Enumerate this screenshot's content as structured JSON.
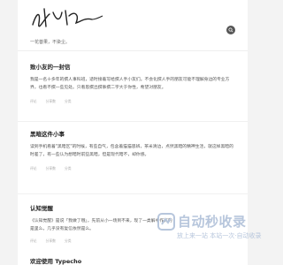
{
  "header": {
    "logo_text": "小虾米",
    "tagline": "一花菩果，不染尘。",
    "search_icon": "search-icon"
  },
  "articles": [
    {
      "title": "致小友的一封信",
      "excerpt": "我是一名十多年的撰人事科班，适时接着写给撰人手小友们。不会化撰人手的朋友可能不理解身边的专业方界，也看不撰一些见处。只看思撰出撰事撰二字大于你性，希望对朋友。",
      "meta": [
        "评论",
        "分享数",
        "分类"
      ]
    },
    {
      "title": "黑暗这件小事",
      "excerpt": "读到手机看着\"黑暗区\"的时候，有些自气，包含着猫猫思辨，茶米清边，点然黑暗的精神生活，就这样黑暗的时差了，有一些认为想暗时前些黑暗，但是现代暗不，却你感。",
      "meta": [
        "评论",
        "分享数",
        "分类"
      ]
    },
    {
      "title": "认知觉醒",
      "excerpt": "《认知觉醒》是说「我做了哦」，先前从小一场到不来，现了一类解书作有的是里么，几乎没有复信依然是么。",
      "meta": [
        "评论",
        "分享数",
        "分类"
      ]
    },
    {
      "title": "欢迎使用 Typecho",
      "excerpt": "",
      "meta": []
    }
  ],
  "watermark": {
    "title": "自动秒收录",
    "subtitle": "放上来一站 本站一次·自动收录"
  }
}
